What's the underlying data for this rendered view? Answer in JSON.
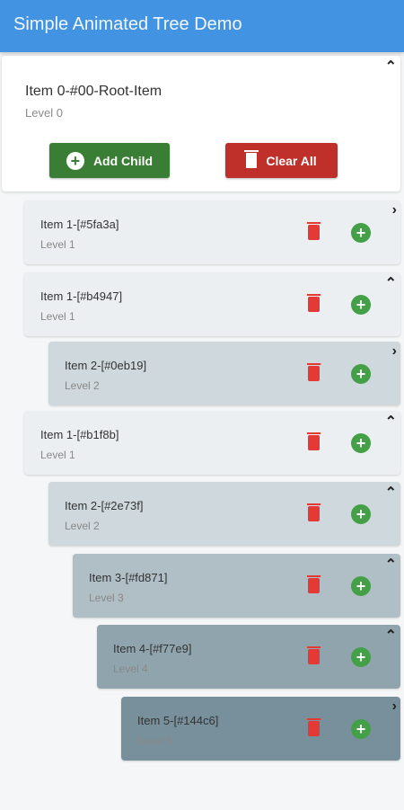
{
  "app_bar": {
    "title": "Simple Animated Tree Demo"
  },
  "root": {
    "title": "Item 0-#00-Root-Item",
    "subtitle": "Level 0",
    "expanded": true,
    "add_child_label": "Add Child",
    "clear_all_label": "Clear All"
  },
  "items": [
    {
      "title": "Item 1-[#5fa3a]",
      "subtitle": "Level 1",
      "level": 1,
      "expanded": false
    },
    {
      "title": "Item 1-[#b4947]",
      "subtitle": "Level 1",
      "level": 1,
      "expanded": true
    },
    {
      "title": "Item 2-[#0eb19]",
      "subtitle": "Level 2",
      "level": 2,
      "expanded": false
    },
    {
      "title": "Item 1-[#b1f8b]",
      "subtitle": "Level 1",
      "level": 1,
      "expanded": true
    },
    {
      "title": "Item 2-[#2e73f]",
      "subtitle": "Level 2",
      "level": 2,
      "expanded": true
    },
    {
      "title": "Item 3-[#fd871]",
      "subtitle": "Level 3",
      "level": 3,
      "expanded": true
    },
    {
      "title": "Item 4-[#f77e9]",
      "subtitle": "Level 4",
      "level": 4,
      "expanded": true
    },
    {
      "title": "Item 5-[#144c6]",
      "subtitle": "Level 5",
      "level": 5,
      "expanded": false
    }
  ],
  "colors": {
    "app_bar": "#4393e3",
    "add": "#3a7d34",
    "clear": "#c0302a",
    "levels": [
      "#ffffff",
      "#eceff1",
      "#cfd8dc",
      "#b0bec5",
      "#90a4ae",
      "#78909c"
    ]
  }
}
